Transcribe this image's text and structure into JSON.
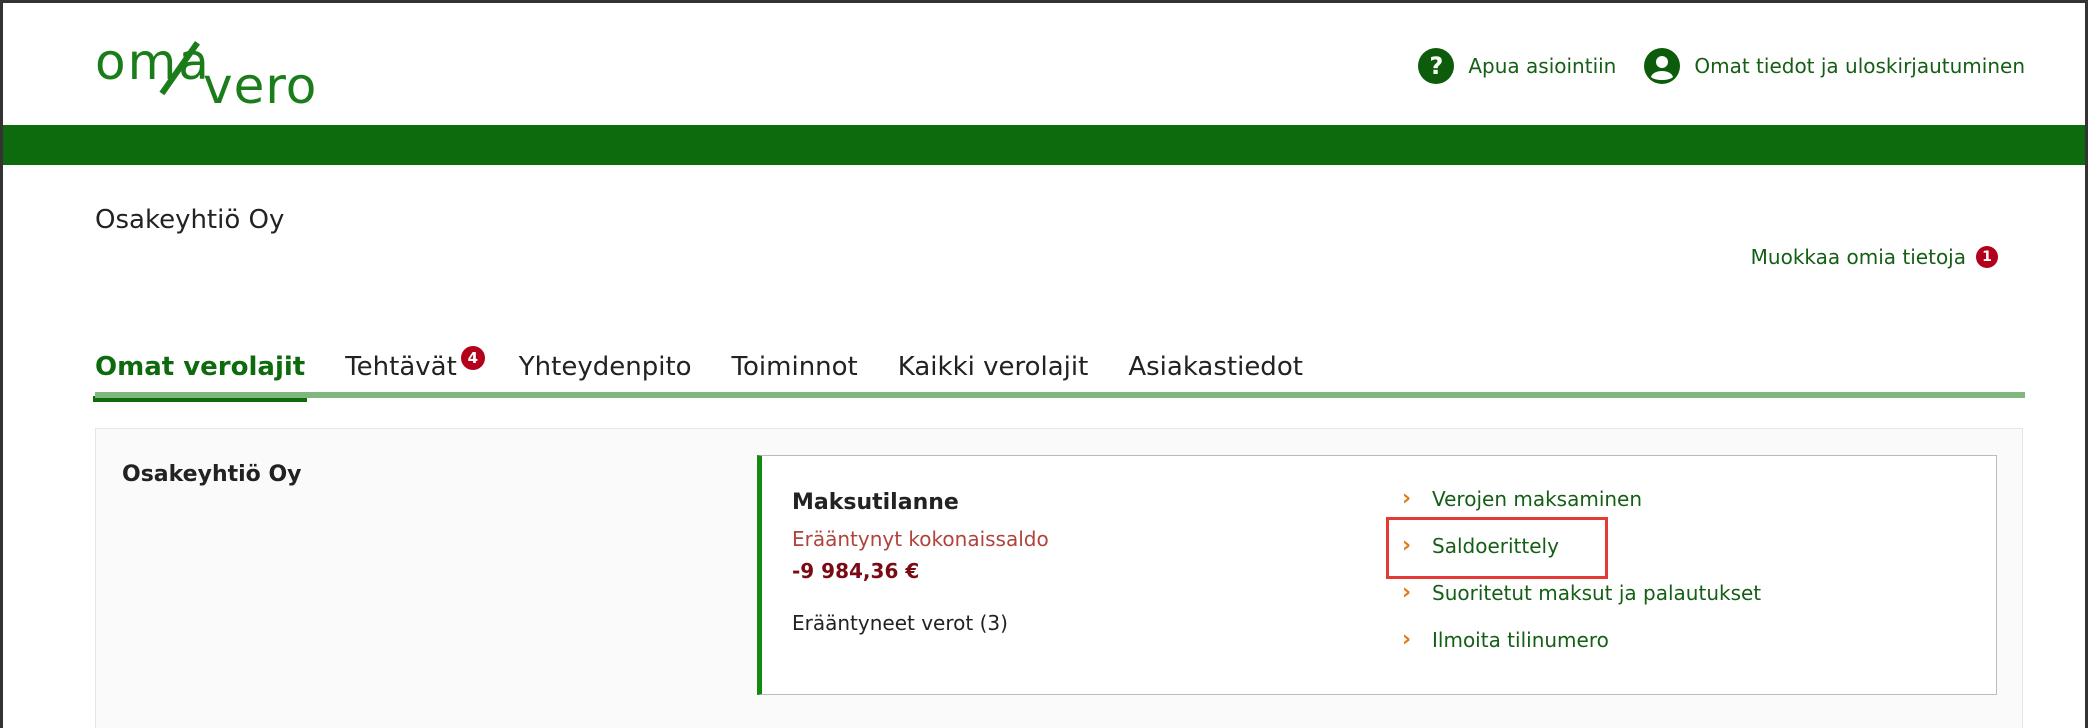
{
  "header": {
    "logo_oma": "oma",
    "logo_vero": "vero",
    "help_label": "Apua asiointiin",
    "account_label": "Omat tiedot ja uloskirjautuminen"
  },
  "company": {
    "title": "Osakeyhtiö Oy",
    "edit_label": "Muokkaa omia tietoja",
    "edit_badge": "1"
  },
  "tabs": [
    {
      "label": "Omat verolajit",
      "active": true
    },
    {
      "label": "Tehtävät",
      "badge": "4"
    },
    {
      "label": "Yhteydenpito"
    },
    {
      "label": "Toiminnot"
    },
    {
      "label": "Kaikki verolajit"
    },
    {
      "label": "Asiakastiedot"
    }
  ],
  "card": {
    "title": "Osakeyhtiö Oy",
    "status_title": "Maksutilanne",
    "overdue_label": "Erääntynyt kokonaissaldo",
    "overdue_amount": "-9 984,36 €",
    "overdue_taxes": "Erääntyneet verot (3)",
    "links": [
      {
        "label": "Verojen maksaminen"
      },
      {
        "label": "Saldoerittely",
        "highlighted": true
      },
      {
        "label": "Suoritetut maksut ja palautukset"
      },
      {
        "label": "Ilmoita tilinumero"
      }
    ]
  },
  "colors": {
    "brand_green": "#0d6b0d",
    "link_green": "#155e15",
    "highlight_red": "#e53935",
    "badge_red": "#b3001b",
    "chevron_orange": "#e07b16"
  }
}
